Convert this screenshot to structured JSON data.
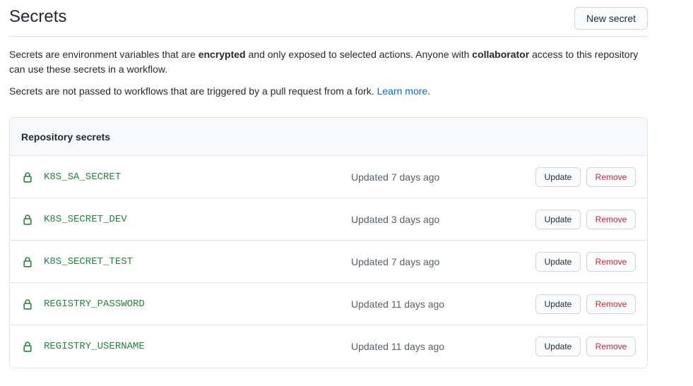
{
  "header": {
    "title": "Secrets",
    "new_secret_label": "New secret"
  },
  "description": {
    "p1_a": "Secrets are environment variables that are ",
    "p1_b": "encrypted",
    "p1_c": " and only exposed to selected actions. Anyone with ",
    "p1_d": "collaborator",
    "p1_e": " access to this repository can use these secrets in a workflow.",
    "p2_a": "Secrets are not passed to workflows that are triggered by a pull request from a fork. ",
    "p2_link": "Learn more",
    "p2_end": "."
  },
  "repository_secrets": {
    "heading": "Repository secrets",
    "update_label": "Update",
    "remove_label": "Remove",
    "rows": [
      {
        "name": "K8S_SA_SECRET",
        "updated": "Updated 7 days ago"
      },
      {
        "name": "K8S_SECRET_DEV",
        "updated": "Updated 3 days ago"
      },
      {
        "name": "K8S_SECRET_TEST",
        "updated": "Updated 7 days ago"
      },
      {
        "name": "REGISTRY_PASSWORD",
        "updated": "Updated 11 days ago"
      },
      {
        "name": "REGISTRY_USERNAME",
        "updated": "Updated 11 days ago"
      }
    ]
  },
  "colors": {
    "lock_icon": "#22863a",
    "secret_name": "#22863a",
    "remove_text": "#cb2431",
    "link": "#0366d6"
  },
  "icons": {
    "row_icon": "lock-icon"
  }
}
